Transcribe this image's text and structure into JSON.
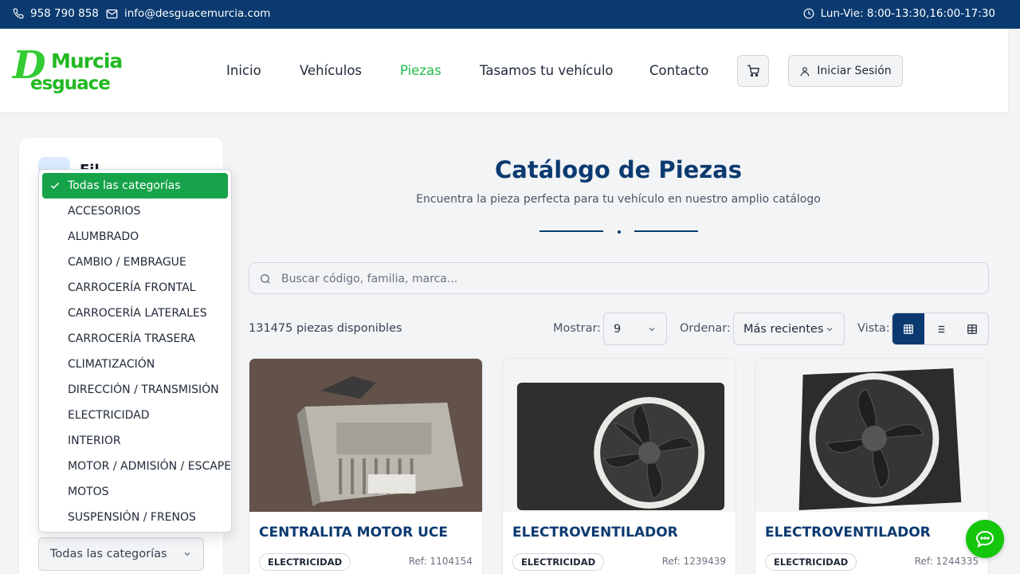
{
  "topbar": {
    "phone": "958 790 858",
    "email": "info@desguacemurcia.com",
    "hours": "Lun-Vie: 8:00-13:30,16:00-17:30"
  },
  "logo": {
    "line1a": "D",
    "line1b": "Murcia",
    "line2": "esguace"
  },
  "nav": {
    "items": [
      "Inicio",
      "Vehículos",
      "Piezas",
      "Tasamos tu vehículo",
      "Contacto"
    ],
    "active": "Piezas",
    "login_label": "Iniciar Sesión"
  },
  "sidebar": {
    "title": "Fil",
    "category_select_value": "Todas las categorías",
    "category_options": [
      "Todas las categorías",
      "ACCESORIOS",
      "ALUMBRADO",
      "CAMBIO / EMBRAGUE",
      "CARROCERÍA FRONTAL",
      "CARROCERÍA LATERALES",
      "CARROCERÍA TRASERA",
      "CLIMATIZACIÓN",
      "DIRECCIÓN / TRANSMISIÓN",
      "ELECTRICIDAD",
      "INTERIOR",
      "MOTOR / ADMISIÓN / ESCAPE",
      "MOTOS",
      "SUSPENSIÓN / FRENOS"
    ],
    "selected_option": "Todas las categorías"
  },
  "main": {
    "title": "Catálogo de Piezas",
    "subtitle": "Encuentra la pieza perfecta para tu vehículo en nuestro amplio catálogo",
    "search_placeholder": "Buscar código, familia, marca...",
    "count_text": "131475 piezas disponibles",
    "show_label": "Mostrar:",
    "show_value": "9",
    "order_label": "Ordenar:",
    "order_value": "Más recientes",
    "view_label": "Vista:"
  },
  "products": [
    {
      "title": "CENTRALITA MOTOR UCE",
      "category": "ELECTRICIDAD",
      "ref": "Ref: 1104154",
      "image": "ecu-unit"
    },
    {
      "title": "ELECTROVENTILADOR",
      "category": "ELECTRICIDAD",
      "ref": "Ref: 1239439",
      "image": "radiator-fan"
    },
    {
      "title": "ELECTROVENTILADOR",
      "category": "ELECTRICIDAD",
      "ref": "Ref: 1244335",
      "image": "radiator-fan"
    }
  ],
  "colors": {
    "primary": "#0b3a70",
    "accent": "#22b94a",
    "chat": "#16c60c"
  }
}
